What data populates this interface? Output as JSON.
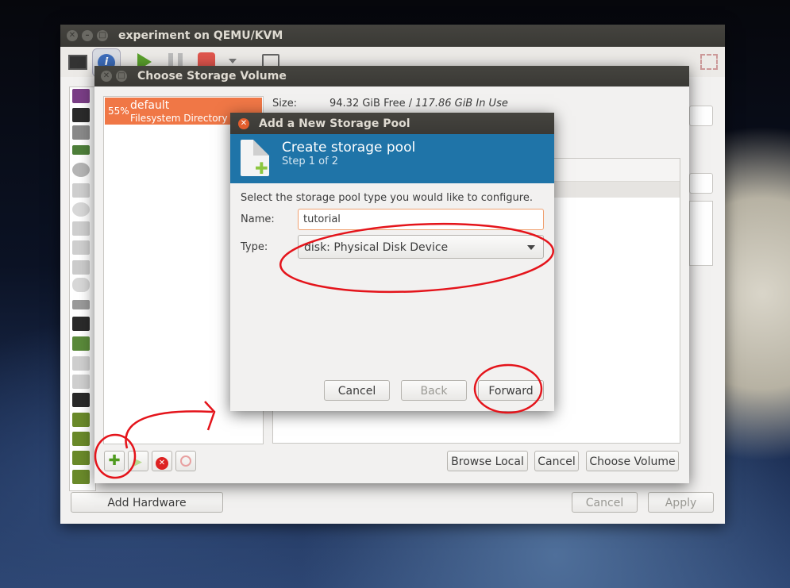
{
  "main_window": {
    "title": "experiment on QEMU/KVM",
    "add_hardware": "Add Hardware",
    "cancel": "Cancel",
    "apply": "Apply"
  },
  "storage_volume": {
    "title": "Choose Storage Volume",
    "pool": {
      "percent": "55%",
      "name": "default",
      "type": "Filesystem Directory"
    },
    "size_label": "Size:",
    "size_free": "94.32 GiB Free / ",
    "size_inuse": "117.86 GiB In Use",
    "browse_local": "Browse Local",
    "cancel": "Cancel",
    "choose_volume": "Choose Volume"
  },
  "dialog": {
    "title": "Add a New Storage Pool",
    "header_title": "Create storage pool",
    "header_step": "Step 1 of 2",
    "instruction": "Select the storage pool type you would like to configure.",
    "name_label": "Name:",
    "name_value": "tutorial",
    "type_label": "Type:",
    "type_value": "disk: Physical Disk Device",
    "cancel": "Cancel",
    "back": "Back",
    "forward": "Forward"
  },
  "colors": {
    "accent_orange": "#f07746",
    "header_blue": "#1f74a8",
    "annotation_red": "#e4141b"
  }
}
